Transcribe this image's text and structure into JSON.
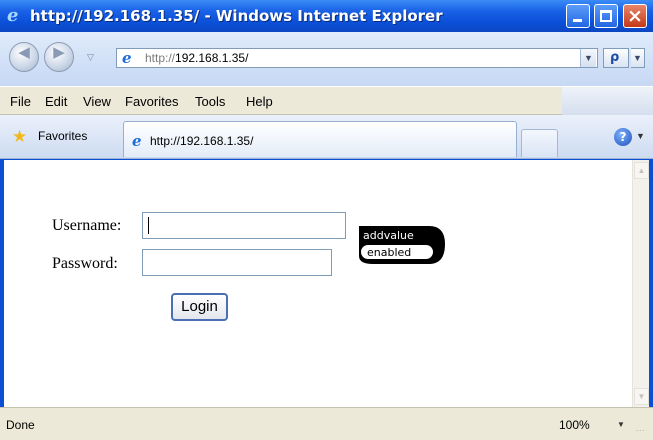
{
  "window": {
    "title": "http://192.168.1.35/ - Windows Internet Explorer"
  },
  "address_bar": {
    "url_prefix": "http://",
    "url_host": "192.168.1.35/"
  },
  "menu": {
    "items": [
      "File",
      "Edit",
      "View",
      "Favorites",
      "Tools",
      "Help"
    ]
  },
  "toolbar": {
    "favorites_label": "Favorites",
    "tab_title": "http://192.168.1.35/"
  },
  "login_form": {
    "username_label": "Username:",
    "username_value": "",
    "password_label": "Password:",
    "password_value": "",
    "login_button_label": "Login"
  },
  "logo": {
    "line1": "addvalue",
    "line2": "enabled"
  },
  "status_bar": {
    "status": "Done",
    "zoom": "100%"
  },
  "colors": {
    "titlebar": "#0a50d8",
    "chrome": "#ece9d8",
    "field_border": "#7f9db9",
    "logo_black": "#000000"
  },
  "icons": [
    "ie-logo-icon",
    "back-arrow-icon",
    "forward-arrow-icon",
    "search-icon",
    "favorites-star-icon",
    "help-icon",
    "minimize-icon",
    "maximize-icon",
    "close-icon"
  ]
}
